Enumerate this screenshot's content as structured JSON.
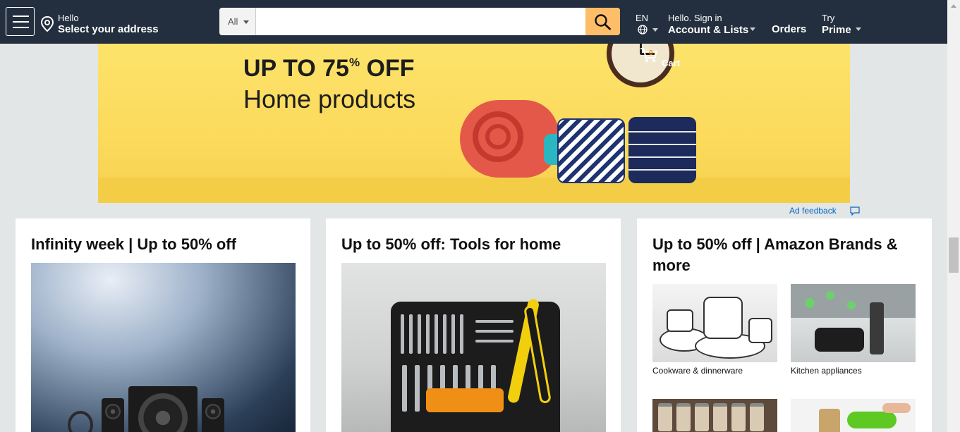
{
  "header": {
    "menu_icon": "hamburger-menu-icon",
    "address": {
      "line1": "Hello",
      "line2": "Select your address",
      "icon": "location-pin-icon"
    },
    "search": {
      "department": "All",
      "placeholder": "",
      "value": "",
      "icon": "search-icon"
    },
    "language": {
      "code": "EN",
      "icon": "globe-icon"
    },
    "account": {
      "line1": "Hello. Sign in",
      "line2": "Account & Lists"
    },
    "orders": {
      "label": "Orders"
    },
    "prime": {
      "line1": "Try",
      "line2": "Prime"
    },
    "cart": {
      "count": "0",
      "label": "Cart",
      "icon": "cart-icon"
    }
  },
  "banner": {
    "headline_prefix": "UP TO 75",
    "headline_sup": "%",
    "headline_suffix": " OFF",
    "subheadline": "Home products"
  },
  "ad_feedback": {
    "label": "Ad feedback",
    "icon": "feedback-bubble-icon"
  },
  "cards": [
    {
      "title": "Infinity week | Up to 50% off"
    },
    {
      "title": "Up to 50% off: Tools for home"
    },
    {
      "title": "Up to 50% off | Amazon Brands & more",
      "items": [
        {
          "label": "Cookware & dinnerware"
        },
        {
          "label": "Kitchen appliances"
        },
        {
          "label": ""
        },
        {
          "label": ""
        }
      ]
    }
  ],
  "colors": {
    "header_bg": "#232f3e",
    "search_button": "#febd69",
    "page_bg": "#e3e6e6",
    "link": "#0066c0"
  }
}
